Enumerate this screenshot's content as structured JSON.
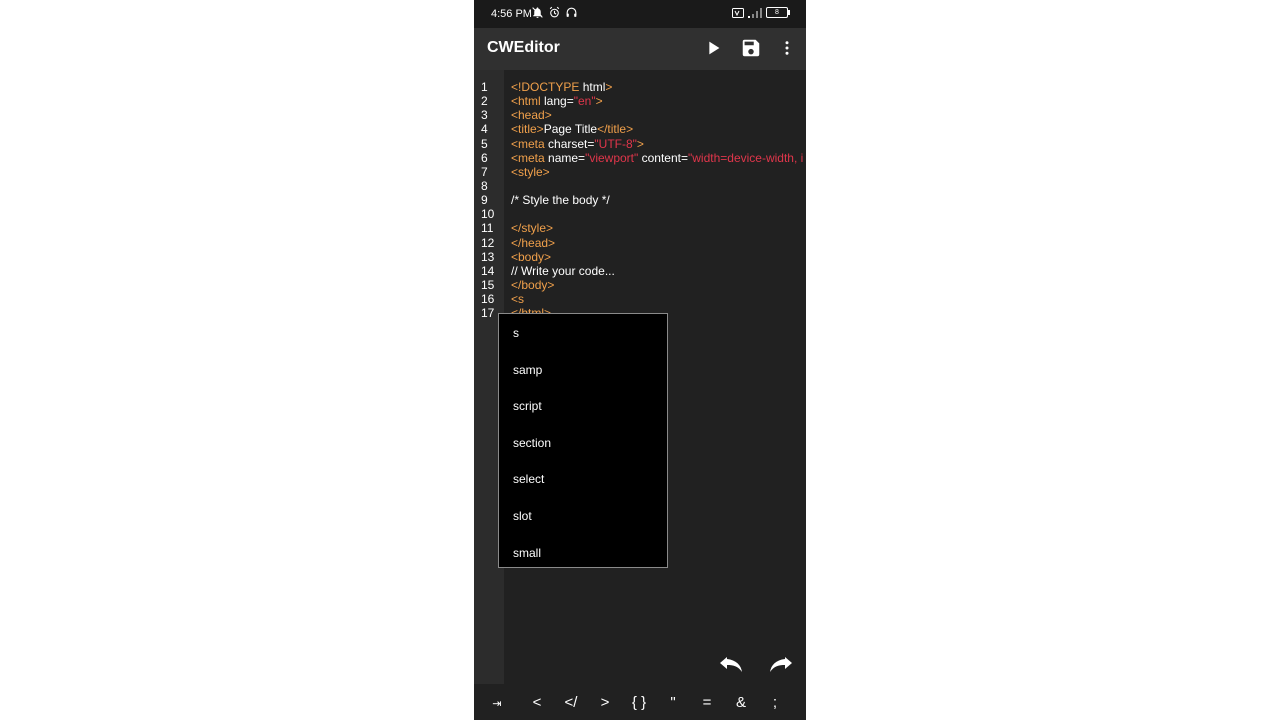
{
  "status_bar": {
    "time": "4:56 PM",
    "battery": "8"
  },
  "app_bar": {
    "title": "CWEditor",
    "actions": [
      "play-icon",
      "save-icon",
      "more-vert-icon"
    ]
  },
  "editor": {
    "line_numbers": [
      "1",
      "2",
      "3",
      "4",
      "5",
      "6",
      "7",
      "8",
      "9",
      "10",
      "11",
      "12",
      "13",
      "14",
      "15",
      "16",
      "17"
    ],
    "lines": [
      [
        {
          "t": "<!DOCTYPE ",
          "c": "tag"
        },
        {
          "t": "html",
          "c": "txt"
        },
        {
          "t": ">",
          "c": "tag"
        }
      ],
      [
        {
          "t": "<html ",
          "c": "tag"
        },
        {
          "t": "lang=",
          "c": "txt"
        },
        {
          "t": "\"en\"",
          "c": "str"
        },
        {
          "t": ">",
          "c": "tag"
        }
      ],
      [
        {
          "t": "<head>",
          "c": "tag"
        }
      ],
      [
        {
          "t": "<title>",
          "c": "tag"
        },
        {
          "t": "Page Title",
          "c": "txt"
        },
        {
          "t": "</title>",
          "c": "tag"
        }
      ],
      [
        {
          "t": "<meta ",
          "c": "tag"
        },
        {
          "t": "charset=",
          "c": "txt"
        },
        {
          "t": "\"UTF-8\"",
          "c": "str"
        },
        {
          "t": ">",
          "c": "tag"
        }
      ],
      [
        {
          "t": "<meta ",
          "c": "tag"
        },
        {
          "t": "name=",
          "c": "txt"
        },
        {
          "t": "\"viewport\"",
          "c": "str"
        },
        {
          "t": " content=",
          "c": "txt"
        },
        {
          "t": "\"width=device-width, i",
          "c": "str"
        }
      ],
      [
        {
          "t": "<style>",
          "c": "tag"
        }
      ],
      [],
      [
        {
          "t": "/* Style the body */",
          "c": "txt"
        }
      ],
      [],
      [
        {
          "t": "</style>",
          "c": "tag"
        }
      ],
      [
        {
          "t": "</head>",
          "c": "tag"
        }
      ],
      [
        {
          "t": "<body>",
          "c": "tag"
        }
      ],
      [
        {
          "t": "// Write your code...",
          "c": "txt"
        }
      ],
      [
        {
          "t": "</body>",
          "c": "tag"
        }
      ],
      [
        {
          "t": "<s",
          "c": "tag"
        }
      ],
      [
        {
          "t": "</html>",
          "c": "tag"
        }
      ]
    ]
  },
  "autocomplete": {
    "items": [
      "s",
      "samp",
      "script",
      "section",
      "select",
      "slot",
      "small"
    ]
  },
  "symbol_bar": {
    "keys": [
      "⇥",
      "<",
      "</",
      ">",
      "{ }",
      "\"",
      "=",
      "&",
      ";",
      "/"
    ]
  },
  "colors": {
    "background": "#212121",
    "app_bar": "#303030",
    "tag": "#f0a04b",
    "string": "#e0364b",
    "text": "#ffffff",
    "popup": "#000000"
  }
}
